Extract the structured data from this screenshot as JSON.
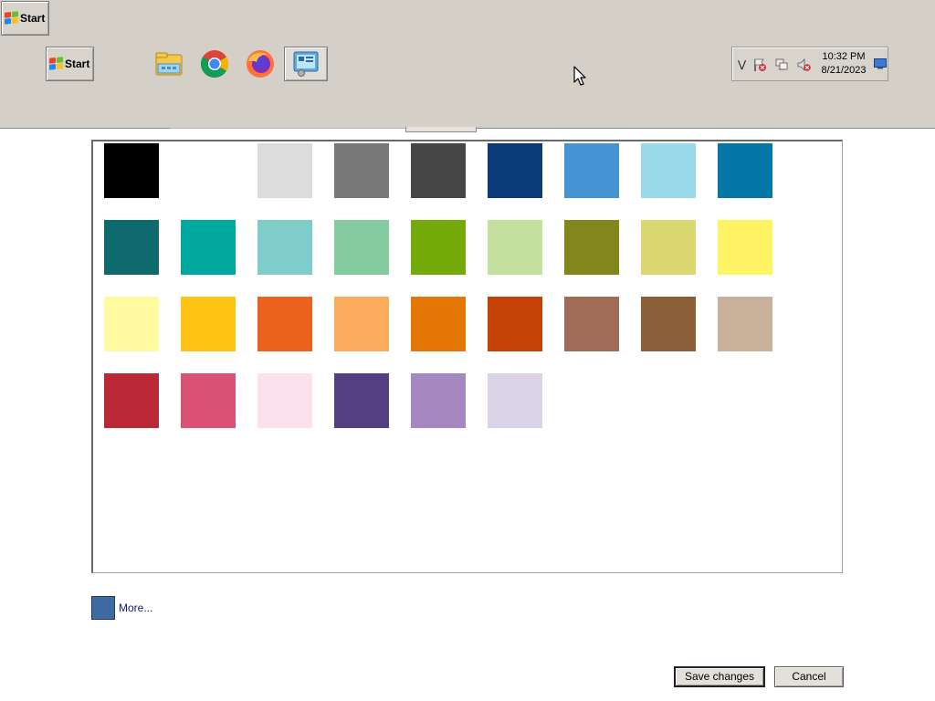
{
  "taskbar": {
    "start_label_top": "Start",
    "start_label_main": "Start",
    "pinned": [
      {
        "name": "file-explorer-icon"
      },
      {
        "name": "chrome-icon"
      },
      {
        "name": "firefox-icon"
      },
      {
        "name": "control-panel-icon"
      }
    ],
    "tray": {
      "time": "10:32 PM",
      "date": "8/21/2023",
      "icons": [
        "action-center-flag-icon",
        "network-icon",
        "volume-muted-icon"
      ]
    }
  },
  "palette": {
    "rows": [
      [
        "#000000",
        "#ffffff",
        "#dcdcdc",
        "#787878",
        "#464646",
        "#0a3a78",
        "#4693d3",
        "#9ad8ec",
        "#0277a6"
      ],
      [
        "#0f6a6e",
        "#00a89e",
        "#7ecdcb",
        "#84cc9f",
        "#74a90a",
        "#c4e09f",
        "#83871b",
        "#dbd771",
        "#fff263"
      ],
      [
        "#fffa9f",
        "#ffc413",
        "#eb621e",
        "#fbab5b",
        "#e47606",
        "#c54206",
        "#a06c56",
        "#8b6038",
        "#c9b09a"
      ],
      [
        "#ba2835",
        "#d95275",
        "#fce1ed",
        "#553f83",
        "#a588bf",
        "#dad3e7"
      ]
    ]
  },
  "more": {
    "label": "More...",
    "color": "#3e6aa1"
  },
  "buttons": {
    "save": "Save changes",
    "cancel": "Cancel"
  }
}
